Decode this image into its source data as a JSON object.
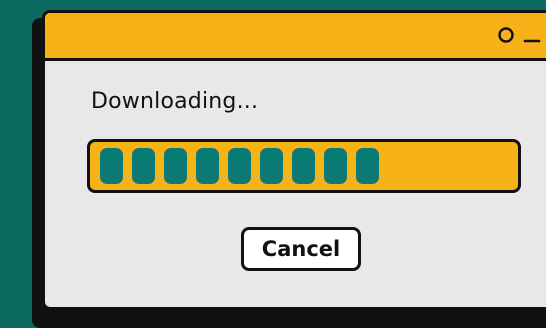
{
  "window": {
    "title": "",
    "controls": [
      {
        "name": "circle-icon",
        "label": ""
      },
      {
        "name": "minimize-icon",
        "label": ""
      },
      {
        "name": "close-icon",
        "label": ""
      }
    ]
  },
  "dialog": {
    "message": "Downloading...",
    "progress": {
      "filled_blocks": 9,
      "fraction": 0.62
    },
    "cancel_label": "Cancel"
  },
  "colors": {
    "background": "#0b6b60",
    "titlebar": "#f7b217",
    "panel": "#e8e8e8",
    "progress_fill": "#0b7a72",
    "border": "#111111"
  }
}
